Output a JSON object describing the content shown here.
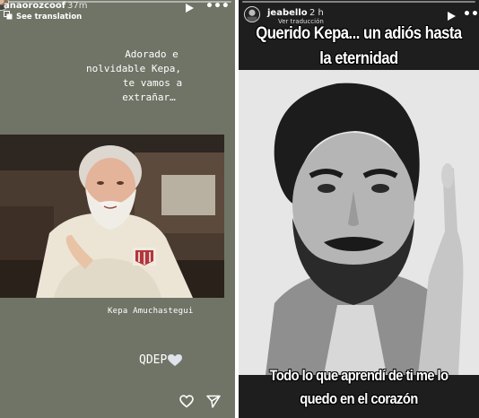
{
  "left_story": {
    "username": "anaorozcoof",
    "time_ago": "37m",
    "translation_label": "See translation",
    "poem_lines": [
      "Adorado e",
      "nolvidable Kepa,",
      "te vamos a",
      "extrañar…"
    ],
    "photo_caption": "Kepa Amuchastegui",
    "closing_text": "QDEP"
  },
  "right_story": {
    "username": "jeabello",
    "time_ago": "2 h",
    "sub_label": "Ver traducción",
    "title_lines": [
      "Querido Kepa... un adiós hasta",
      "la eternidad"
    ],
    "bottom_lines": [
      "Todo lo que aprendí de ti me lo",
      "quedo en el corazón"
    ]
  },
  "icons": {
    "left": [
      "translate-icon",
      "play-icon",
      "more-icon",
      "heart-icon",
      "send-icon"
    ],
    "right": [
      "play-icon",
      "more-icon"
    ]
  },
  "colors": {
    "left_background": "#6f7466",
    "right_background": "#1e1e1e",
    "text": "#ffffff"
  }
}
